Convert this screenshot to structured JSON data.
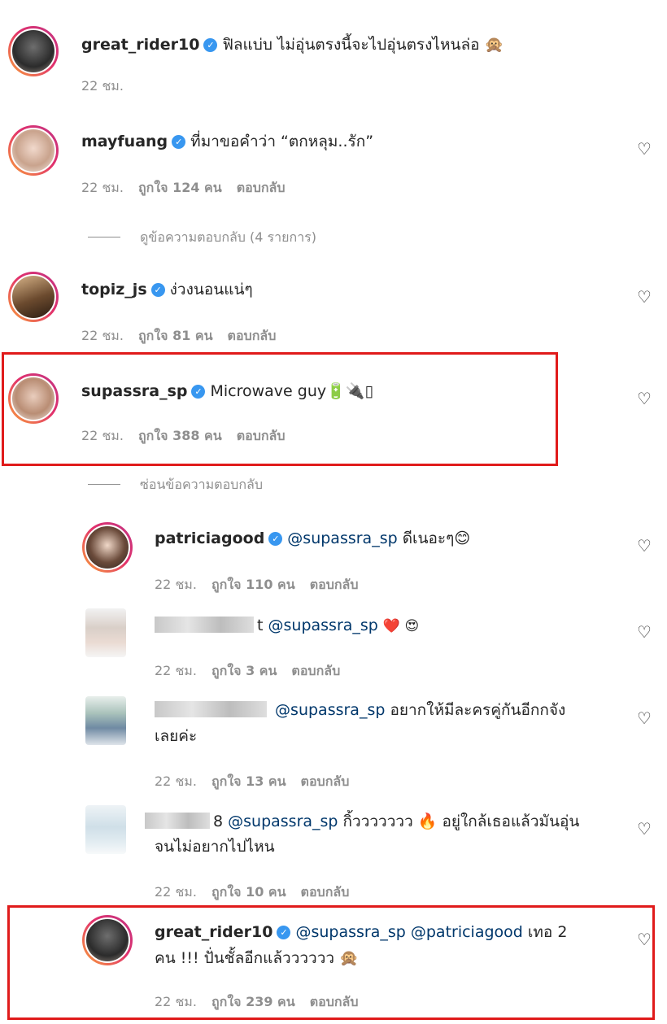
{
  "comments": [
    {
      "user": "great_rider10",
      "text": "ฟิลแบ่บ ไม่อุ่นตรงนี้จะไปอุ่นตรงไหนล่อ 🙊",
      "time": "22 ชม."
    },
    {
      "user": "mayfuang",
      "text": "ที่มาขอคำว่า “ตกหลุม..รัก”",
      "time": "22 ชม.",
      "likes": "ถูกใจ 124 คน",
      "reply": "ตอบกลับ"
    },
    {
      "user": "topiz_js",
      "text": "ง่วงนอนแน่ๆ",
      "time": "22 ชม.",
      "likes": "ถูกใจ 81 คน",
      "reply": "ตอบกลับ"
    },
    {
      "user": "supassra_sp",
      "text": "Microwave guy🔋🔌▯",
      "time": "22 ชม.",
      "likes": "ถูกใจ 388 คน",
      "reply": "ตอบกลับ"
    }
  ],
  "view_replies": "ดูข้อความตอบกลับ (4 รายการ)",
  "hide_replies": "ซ่อนข้อความตอบกลับ",
  "replies": [
    {
      "user": "patriciagood",
      "mention": "@supassra_sp",
      "text": "ดีเนอะๆ😊",
      "time": "22 ชม.",
      "likes": "ถูกใจ 110 คน",
      "reply": "ตอบกลับ"
    },
    {
      "user_suffix": "t",
      "mention": "@supassra_sp",
      "text": "❤️ 😍",
      "time": "22 ชม.",
      "likes": "ถูกใจ 3 คน",
      "reply": "ตอบกลับ"
    },
    {
      "mention": "@supassra_sp",
      "text": "อยากให้มีละครคู่กันอีกกจัง",
      "text2": "เลยค่ะ",
      "time": "22 ชม.",
      "likes": "ถูกใจ 13 คน",
      "reply": "ตอบกลับ"
    },
    {
      "user_suffix": "8",
      "mention": "@supassra_sp",
      "text": "กิ้ววววววว 🔥 อยู่ใกล้เธอแล้วมันอุ่น",
      "text2": "จนไม่อยากไปไหน",
      "time": "22 ชม.",
      "likes": "ถูกใจ 10 คน",
      "reply": "ตอบกลับ"
    },
    {
      "user": "great_rider10",
      "mention": "@supassra_sp",
      "mention2": "@patriciagood",
      "text": "เทอ 2",
      "text2": "คน !!! ปั่นชั้ลอีกแล้วววววว 🙊",
      "time": "22 ชม.",
      "likes": "ถูกใจ 239 คน",
      "reply": "ตอบกลับ"
    }
  ],
  "colors": {
    "highlight": "#e01b1b",
    "verified": "#3897f0",
    "mention": "#00376b",
    "meta": "#8e8e8e"
  },
  "icons": {
    "heart": "heart-outline-icon",
    "verified": "verified-badge-icon"
  }
}
